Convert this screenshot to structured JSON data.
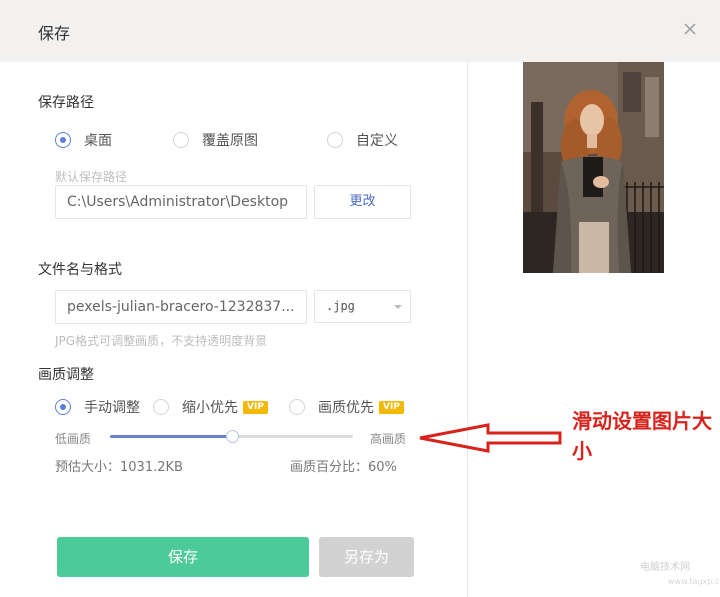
{
  "dialog": {
    "title": "保存"
  },
  "save_path": {
    "section_title": "保存路径",
    "options": [
      {
        "label": "桌面",
        "checked": true
      },
      {
        "label": "覆盖原图",
        "checked": false
      },
      {
        "label": "自定义",
        "checked": false
      }
    ],
    "default_path_hint": "默认保存路径",
    "path_value": "C:\\Users\\Administrator\\Desktop",
    "change_button": "更改"
  },
  "file": {
    "section_title": "文件名与格式",
    "filename": "pexels-julian-bracero-1232837...",
    "format": ".jpg",
    "format_hint": "JPG格式可调整画质，不支持透明度背景"
  },
  "quality": {
    "section_title": "画质调整",
    "modes": [
      {
        "label": "手动调整",
        "checked": true,
        "vip": false
      },
      {
        "label": "缩小优先",
        "checked": false,
        "vip": true
      },
      {
        "label": "画质优先",
        "checked": false,
        "vip": true
      }
    ],
    "vip_badge": "VIP",
    "low_label": "低画质",
    "high_label": "高画质",
    "slider_value": 0.5,
    "estimated_size": "预估大小：1031.2KB",
    "quality_percent": "画质百分比：60%"
  },
  "buttons": {
    "save": "保存",
    "save_as": "另存为"
  },
  "annotation": {
    "text": "滑动设置图片大小"
  },
  "watermark": {
    "line1": "电脑技术网",
    "line2": "www.tagxp.com"
  },
  "colors": {
    "accent": "#5b7ed8",
    "primary_button": "#4ccb98",
    "annotation": "#d8231c",
    "vip": "#f5b800"
  }
}
